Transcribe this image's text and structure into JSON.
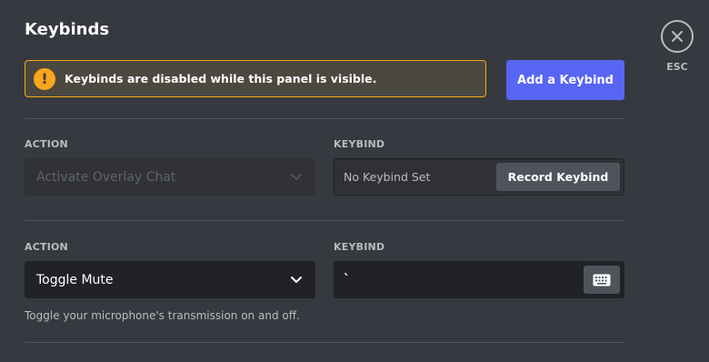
{
  "header": {
    "title": "Keybinds"
  },
  "warning": {
    "icon": "warning-exclamation-icon",
    "glyph": "!",
    "text": "Keybinds are disabled while this panel is visible.",
    "color": "#faa61a"
  },
  "actions": {
    "add_keybind_label": "Add a Keybind",
    "accent": "#5865f2"
  },
  "close": {
    "icon": "close-icon",
    "label": "ESC"
  },
  "keybinds": [
    {
      "action_label": "ACTION",
      "action_value": "Activate Overlay Chat",
      "action_disabled": true,
      "keybind_label": "KEYBIND",
      "keybind_value": "No Keybind Set",
      "record_label": "Record Keybind"
    },
    {
      "action_label": "ACTION",
      "action_value": "Toggle Mute",
      "action_disabled": false,
      "keybind_label": "KEYBIND",
      "keybind_value": "`",
      "keybind_icon": "keyboard-icon",
      "description": "Toggle your microphone's transmission on and off."
    }
  ]
}
